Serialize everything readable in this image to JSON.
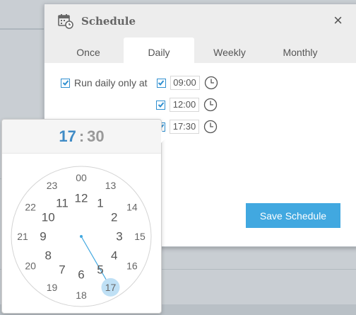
{
  "dialog": {
    "title": "Schedule",
    "close_label": "×",
    "icon": "calendar-clock-icon"
  },
  "tabs": [
    {
      "label": "Once",
      "active": false
    },
    {
      "label": "Daily",
      "active": true
    },
    {
      "label": "Weekly",
      "active": false
    },
    {
      "label": "Monthly",
      "active": false
    }
  ],
  "daily": {
    "run_label": "Run daily only at",
    "run_checked": true,
    "times": [
      {
        "value": "09:00",
        "checked": true
      },
      {
        "value": "12:00",
        "checked": true
      },
      {
        "value": "17:30",
        "checked": true
      }
    ]
  },
  "save_label": "Save Schedule",
  "picker": {
    "hour": "17",
    "separator": ":",
    "minute": "30",
    "inner_hours": [
      "12",
      "1",
      "2",
      "3",
      "4",
      "5",
      "6",
      "7",
      "8",
      "9",
      "10",
      "11"
    ],
    "outer_hours": [
      "00",
      "13",
      "14",
      "15",
      "16",
      "17",
      "18",
      "19",
      "20",
      "21",
      "22",
      "23"
    ],
    "selected": "17"
  },
  "colors": {
    "accent": "#41a8e0",
    "checkbox": "#2e8fd0",
    "hour_text": "#3f8bc6",
    "selection": "#bfe0f5"
  }
}
